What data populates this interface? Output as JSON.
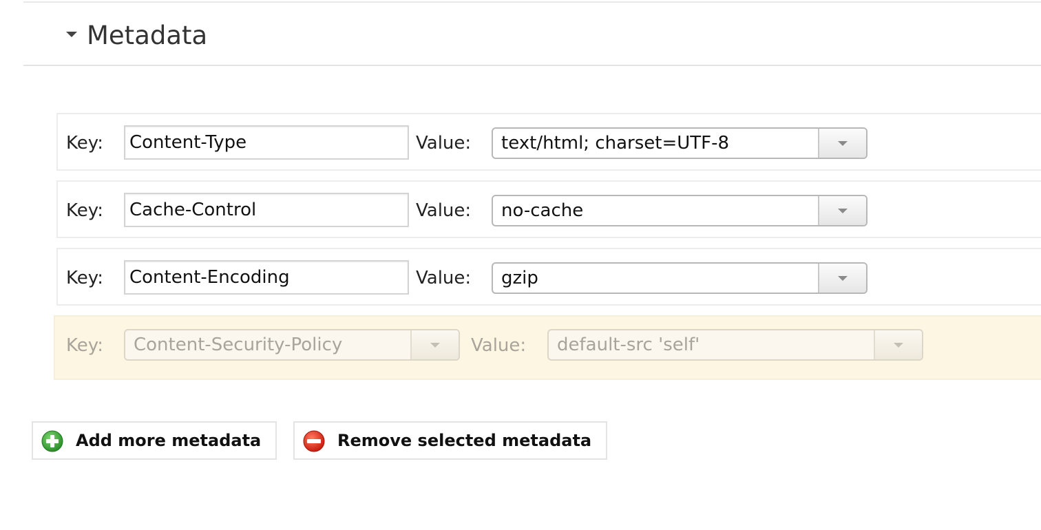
{
  "section": {
    "title": "Metadata"
  },
  "rows": [
    {
      "key_label": "Key:",
      "key": "Content-Type",
      "value_label": "Value:",
      "value": "text/html; charset=UTF-8"
    },
    {
      "key_label": "Key:",
      "key": "Cache-Control",
      "value_label": "Value:",
      "value": "no-cache"
    },
    {
      "key_label": "Key:",
      "key": "Content-Encoding",
      "value_label": "Value:",
      "value": "gzip"
    },
    {
      "key_label": "Key:",
      "key": "Content-Security-Policy",
      "value_label": "Value:",
      "value": "default-src 'self'",
      "state": "selected-disabled"
    }
  ],
  "actions": {
    "add_label": "Add more metadata",
    "remove_label": "Remove selected metadata"
  },
  "icons": {
    "disclosure": "triangle-down-icon",
    "add": "green-plus-circle-icon",
    "remove": "red-minus-circle-icon"
  },
  "colors": {
    "selected_row_bg": "#fdf6e3",
    "add_icon": "#3aa53a",
    "remove_icon": "#e0301e"
  }
}
